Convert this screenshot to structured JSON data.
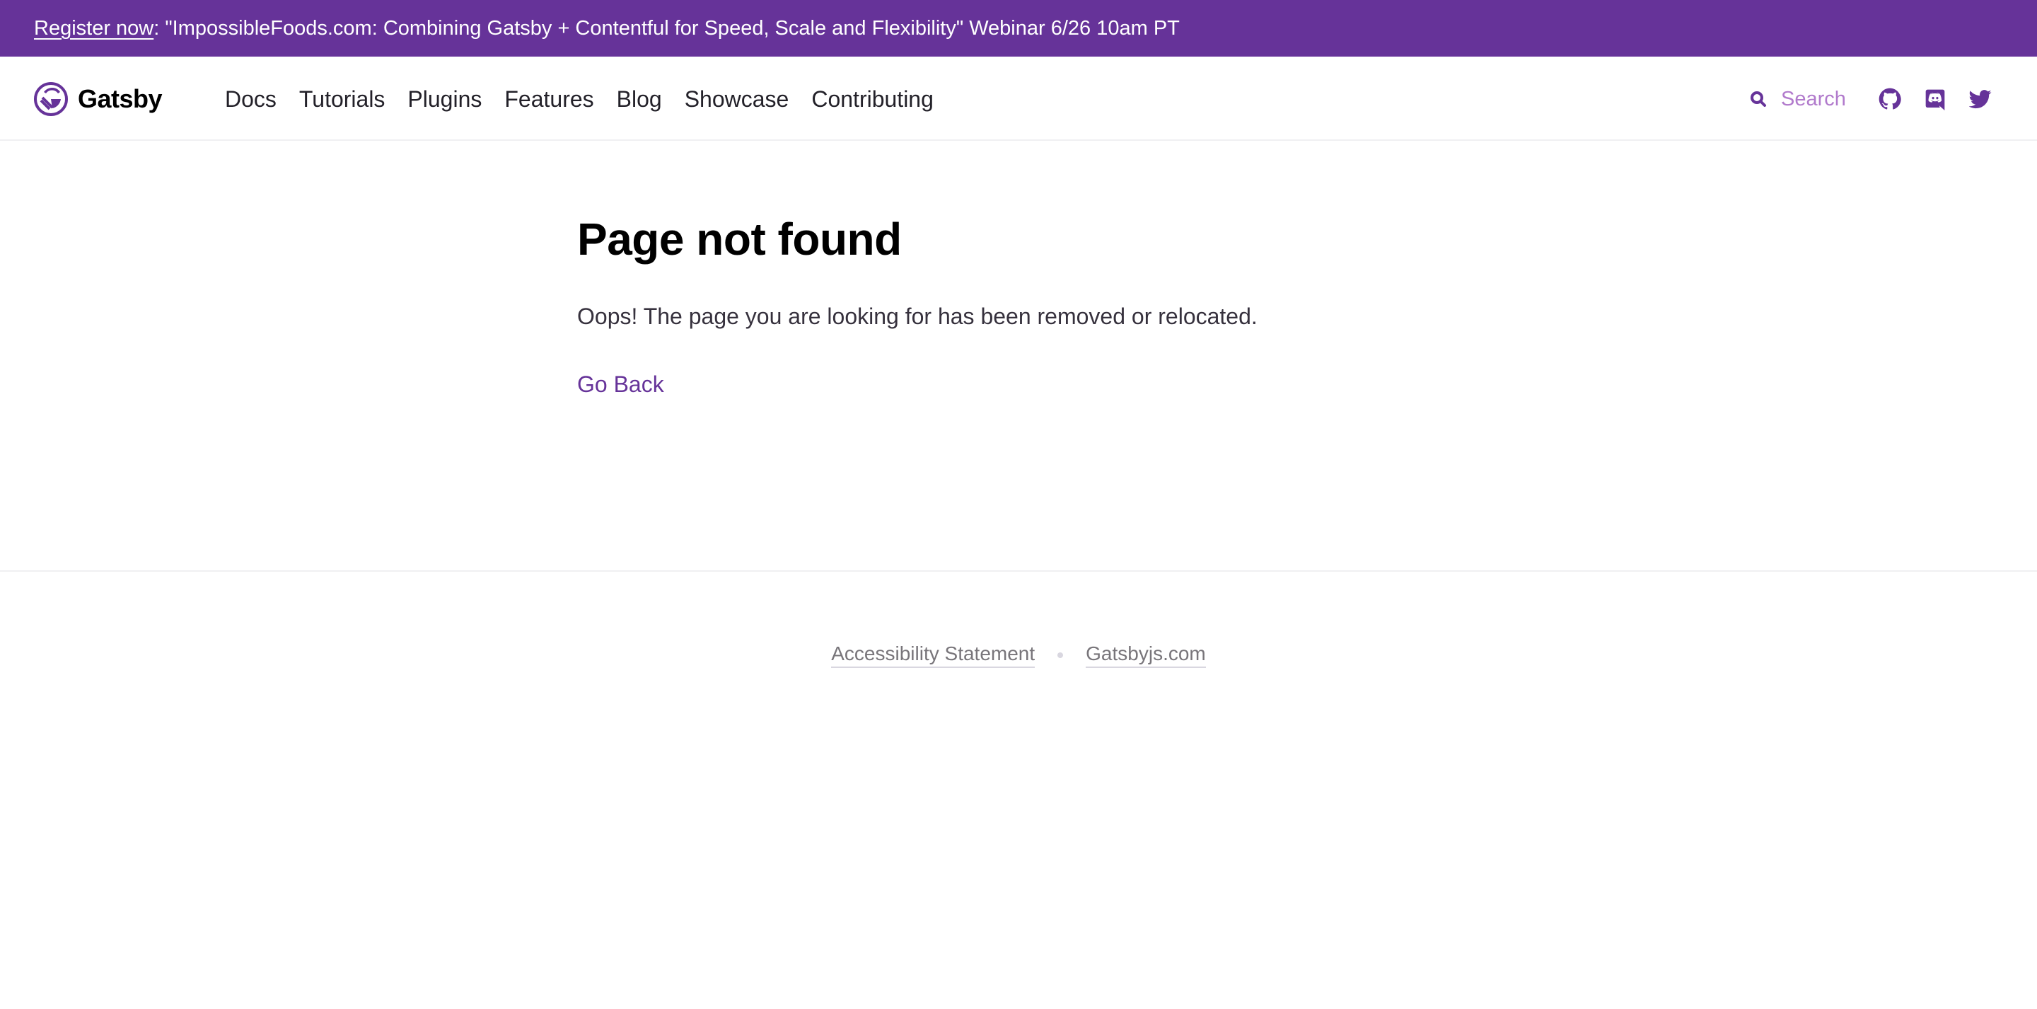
{
  "banner": {
    "link_label": "Register now",
    "text": ": \"ImpossibleFoods.com: Combining Gatsby + Contentful for Speed, Scale and Flexibility\" Webinar 6/26 10am PT",
    "background": "#663399"
  },
  "header": {
    "brand": "Gatsby",
    "logo_icon": "gatsby-logo-icon",
    "nav": [
      {
        "label": "Docs"
      },
      {
        "label": "Tutorials"
      },
      {
        "label": "Plugins"
      },
      {
        "label": "Features"
      },
      {
        "label": "Blog"
      },
      {
        "label": "Showcase"
      },
      {
        "label": "Contributing"
      }
    ],
    "search": {
      "placeholder": "Search",
      "icon": "search-icon"
    },
    "social": [
      {
        "icon": "github-icon"
      },
      {
        "icon": "discord-icon"
      },
      {
        "icon": "twitter-icon"
      }
    ]
  },
  "main": {
    "title": "Page not found",
    "message": "Oops! The page you are looking for has been removed or relocated.",
    "go_back": "Go Back"
  },
  "footer": {
    "links": [
      {
        "label": "Accessibility Statement"
      },
      {
        "label": "Gatsbyjs.com"
      }
    ]
  },
  "colors": {
    "accent": "#663399",
    "search_text": "#b17acc",
    "body_text": "#36313d",
    "footer_text": "#78757a"
  }
}
